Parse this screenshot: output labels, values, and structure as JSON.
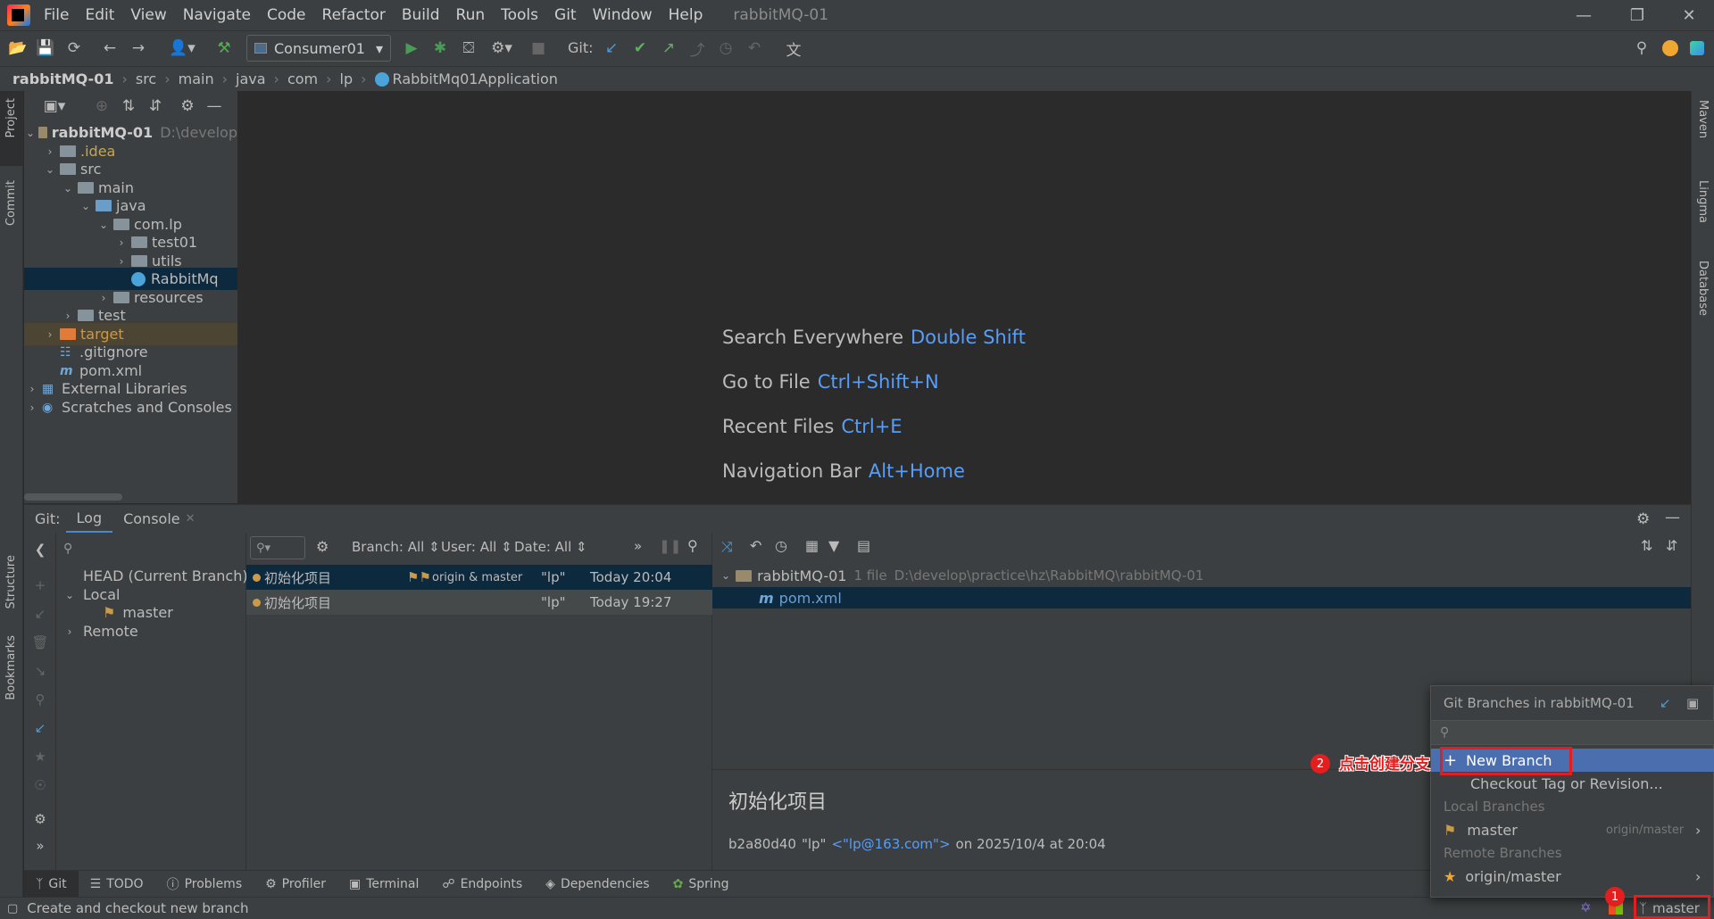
{
  "menubar": {
    "items": [
      "File",
      "Edit",
      "View",
      "Navigate",
      "Code",
      "Refactor",
      "Build",
      "Run",
      "Tools",
      "Git",
      "Window",
      "Help"
    ],
    "project_title": "rabbitMQ-01"
  },
  "toolbar": {
    "run_config": "Consumer01",
    "git_label": "Git:"
  },
  "breadcrumb": {
    "items": [
      "rabbitMQ-01",
      "src",
      "main",
      "java",
      "com",
      "lp",
      "RabbitMq01Application"
    ]
  },
  "left_strip": {
    "project": "Project",
    "commit": "Commit",
    "structure": "Structure",
    "bookmarks": "Bookmarks"
  },
  "right_strip": {
    "maven": "Maven",
    "lingma": "Lingma",
    "database": "Database"
  },
  "project_tree": {
    "root_name": "rabbitMQ-01",
    "root_path": "D:\\develop",
    "idea": ".idea",
    "src": "src",
    "main": "main",
    "java": "java",
    "pkg": "com.lp",
    "test01": "test01",
    "utils": "utils",
    "app_class": "RabbitMq",
    "resources": "resources",
    "test": "test",
    "target": "target",
    "gitignore": ".gitignore",
    "pom": "pom.xml",
    "ext_libs": "External Libraries",
    "scratches": "Scratches and Consoles"
  },
  "editor_hints": [
    {
      "label": "Search Everywhere",
      "key": "Double Shift"
    },
    {
      "label": "Go to File",
      "key": "Ctrl+Shift+N"
    },
    {
      "label": "Recent Files",
      "key": "Ctrl+E"
    },
    {
      "label": "Navigation Bar",
      "key": "Alt+Home"
    }
  ],
  "git_panel": {
    "title": "Git:",
    "tab_log": "Log",
    "tab_console": "Console",
    "branches": {
      "head": "HEAD (Current Branch)",
      "local": "Local",
      "master": "master",
      "remote": "Remote"
    },
    "filters": {
      "branch": "Branch: All",
      "user": "User: All",
      "date": "Date: All"
    },
    "commits": [
      {
        "message": "初始化项目",
        "refs": "origin & master",
        "author": "\"lp\"",
        "date": "Today 20:04"
      },
      {
        "message": "初始化项目",
        "refs": "",
        "author": "\"lp\"",
        "date": "Today 19:27"
      }
    ],
    "details": {
      "root": "rabbitMQ-01",
      "file_count": "1 file",
      "path": "D:\\develop\\practice\\hz\\RabbitMQ\\rabbitMQ-01",
      "file": "pom.xml",
      "commit_title": "初始化项目",
      "hash": "b2a80d40",
      "author": "\"lp\"",
      "email": "<\"lp@163.com\">",
      "when": "on 2025/10/4 at 20:04"
    }
  },
  "bottom_tabs": [
    "Git",
    "TODO",
    "Problems",
    "Profiler",
    "Terminal",
    "Endpoints",
    "Dependencies",
    "Spring"
  ],
  "status": {
    "message": "Create and checkout new branch",
    "branch": "master"
  },
  "popup": {
    "title": "Git Branches in rabbitMQ-01",
    "new_branch": "New Branch",
    "checkout_tag": "Checkout Tag or Revision...",
    "local_header": "Local Branches",
    "local_master": "master",
    "local_tracking": "origin/master",
    "remote_header": "Remote Branches",
    "remote_master": "origin/master"
  },
  "annotations": {
    "badge1": "1",
    "badge2": "2",
    "callout": "点击创建分支"
  },
  "colors": {
    "accent": "#589df6",
    "selection": "#0d293e",
    "highlight": "#4b6eaf",
    "annotation": "#e21e1e"
  }
}
